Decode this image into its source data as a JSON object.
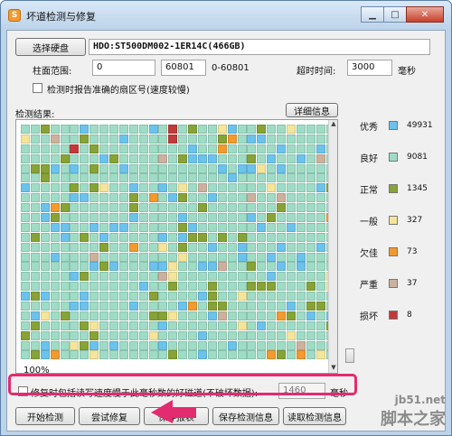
{
  "window": {
    "title": "坏道检测与修复",
    "app_icon_glyph": "S"
  },
  "top": {
    "select_disk_label": "选择硬盘",
    "disk_name": "HDO:ST500DM002-1ER14C(466GB)",
    "cylinder_range_label": "柱面范围:",
    "cylinder_from": "0",
    "arrow_text": "-->",
    "cylinder_to": "60801",
    "cylinder_range_hint": "0-60801",
    "timeout_label": "超时时间:",
    "timeout_value": "3000",
    "timeout_unit": "毫秒",
    "report_checkbox_label": "检测时报告准确的扇区号(速度较慢)"
  },
  "results": {
    "label": "检测结果:",
    "details_button": "详细信息",
    "progress": "100%"
  },
  "legend": [
    {
      "label": "优秀",
      "color": "#6bc3ec",
      "count": "49931"
    },
    {
      "label": "良好",
      "color": "#9fdcc6",
      "count": "9081"
    },
    {
      "label": "正常",
      "color": "#87a336",
      "count": "1345"
    },
    {
      "label": "一般",
      "color": "#f4e59a",
      "count": "327"
    },
    {
      "label": "欠佳",
      "color": "#f29a2e",
      "count": "73"
    },
    {
      "label": "严重",
      "color": "#cdb19f",
      "count": "37"
    },
    {
      "label": "损坏",
      "color": "#c13a3a",
      "count": "8"
    }
  ],
  "repair": {
    "checkbox_label": "修复时包括读写速度慢于此毫秒数的好磁道(不破坏数据):",
    "ms_value": "1460",
    "ms_unit": "毫秒"
  },
  "buttons": {
    "start": "开始检测",
    "try_repair": "尝试修复",
    "save_report": "保存报表",
    "save_detect": "保存检测信息",
    "read_detect": "读取检测信息"
  },
  "watermark": {
    "site": "jb51.net",
    "brand": "脚本之家"
  }
}
